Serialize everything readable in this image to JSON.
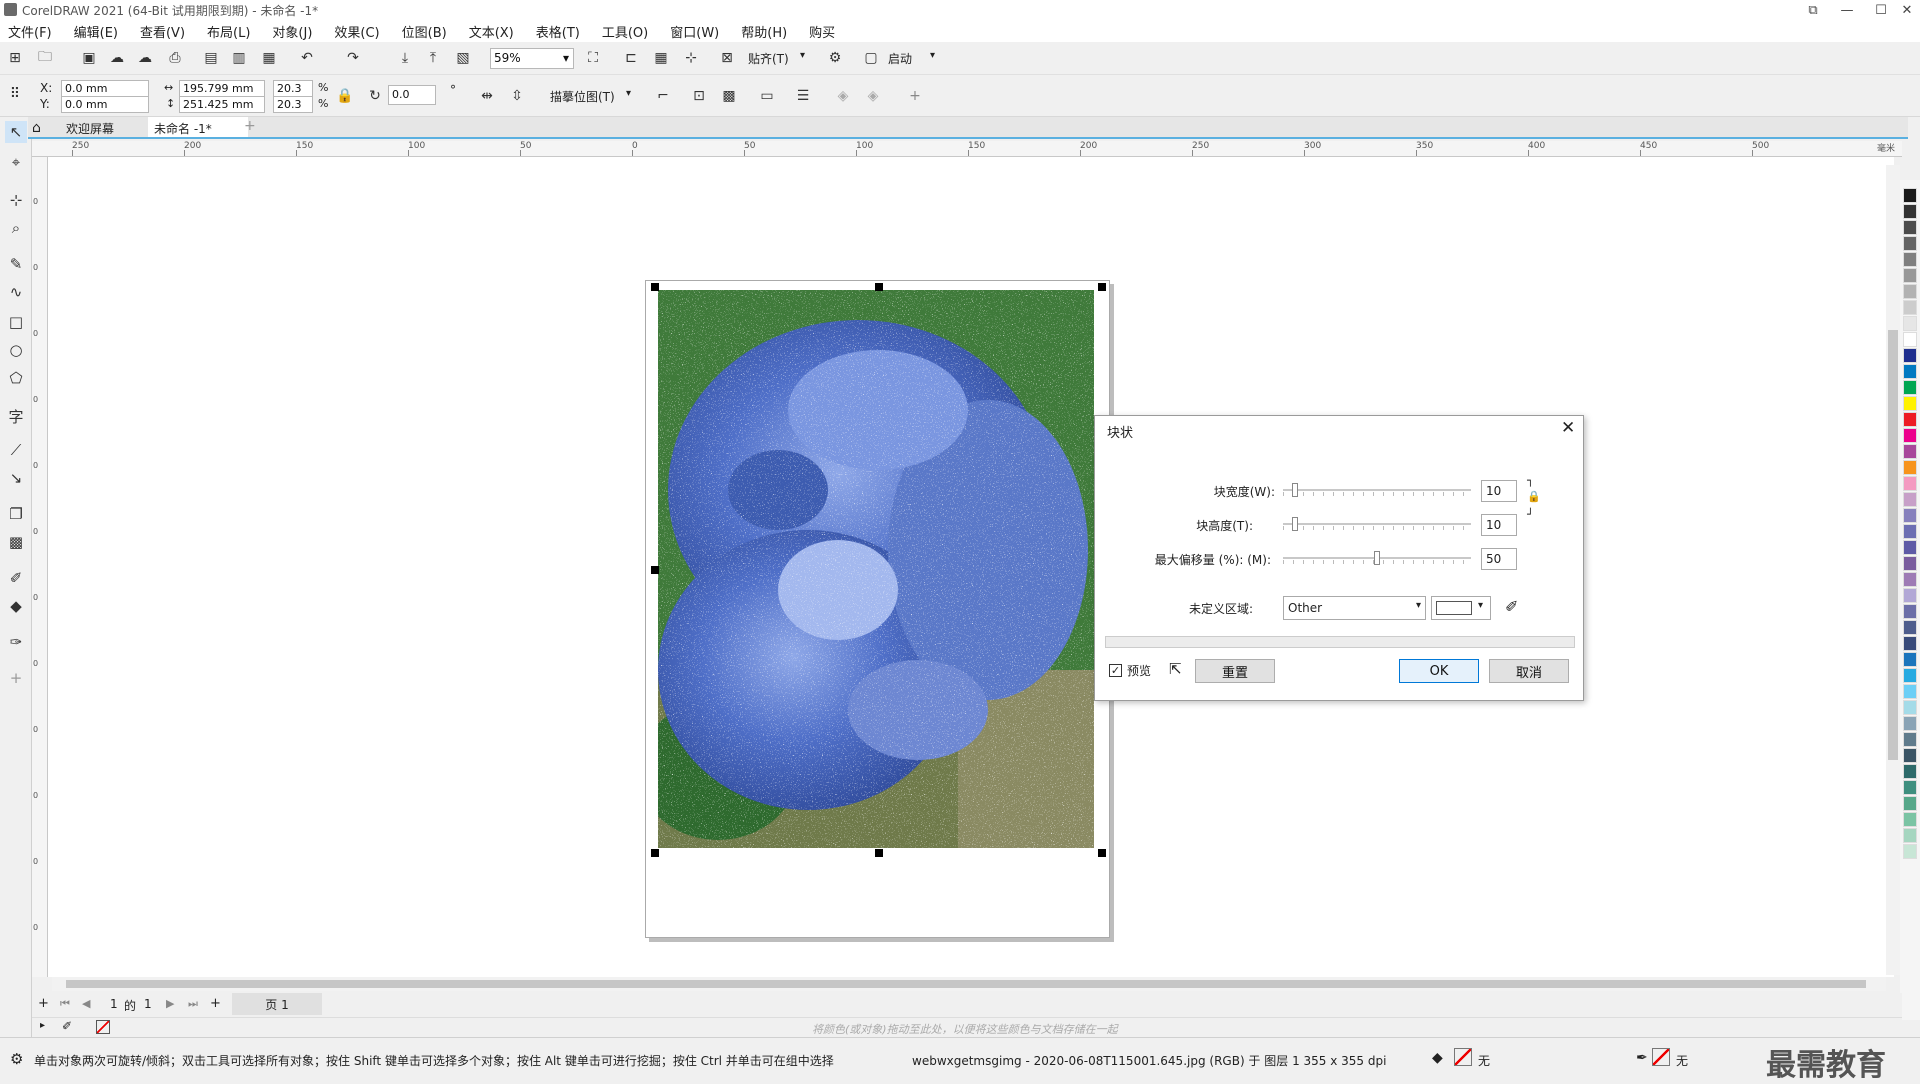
{
  "window": {
    "title": "CorelDRAW 2021 (64-Bit 试用期限到期) - 未命名 -1*"
  },
  "menu": [
    "文件(F)",
    "编辑(E)",
    "查看(V)",
    "布局(L)",
    "对象(J)",
    "效果(C)",
    "位图(B)",
    "文本(X)",
    "表格(T)",
    "工具(O)",
    "窗口(W)",
    "帮助(H)",
    "购买"
  ],
  "toolbar": {
    "zoom": "59%",
    "snap_label": "贴齐(T)",
    "launch_label": "启动"
  },
  "propbar": {
    "x_label": "X:",
    "y_label": "Y:",
    "x_value": "0.0 mm",
    "y_value": "0.0 mm",
    "width_value": "195.799 mm",
    "height_value": "251.425 mm",
    "scale_w": "20.3",
    "scale_h": "20.3",
    "percent": "%",
    "rotation": "0.0",
    "degree": "°",
    "trace_label": "描摹位图(T)"
  },
  "tabs": {
    "welcome": "欢迎屏幕",
    "document": "未命名 -1*"
  },
  "ruler": {
    "h_labels": [
      "250",
      "200",
      "150",
      "100",
      "50",
      "0",
      "50",
      "100",
      "150",
      "200",
      "250",
      "300",
      "350",
      "400",
      "450",
      "500"
    ],
    "unit": "毫米",
    "v_labels": [
      "0",
      "0",
      "0",
      "0",
      "0",
      "0",
      "0",
      "0",
      "0",
      "0",
      "0",
      "0"
    ]
  },
  "dialog": {
    "title": "块状",
    "width_label": "块宽度(W):",
    "height_label": "块高度(T):",
    "offset_label": "最大偏移量 (%): (M):",
    "undefined_label": "未定义区域:",
    "width_value": "10",
    "height_value": "10",
    "offset_value": "50",
    "width_level": 0.05,
    "height_level": 0.05,
    "offset_level": 0.5,
    "undefined_option": "Other",
    "preview_label": "预览",
    "preview_checked": true,
    "reset_label": "重置",
    "ok_label": "OK",
    "cancel_label": "取消"
  },
  "pagenav": {
    "current": "1",
    "of": "的",
    "total": "1",
    "page_tab": "页 1"
  },
  "colorbar_hint": "将颜色(或对象)拖动至此处，以便将这些颜色与文档存储在一起",
  "status": {
    "hint": "单击对象两次可旋转/倾斜；双击工具可选择所有对象；按住 Shift 键单击可选择多个对象；按住 Alt 键单击可进行挖掘；按住 Ctrl 并单击可在组中选择",
    "object_info": "webwxgetmsgimg - 2020-06-08T115001.645.jpg (RGB) 于 图层 1 355 x 355 dpi",
    "fill_none": "无",
    "outline_none": "无"
  },
  "watermark": "最需教育",
  "palette_colors": [
    "#1a1a1a",
    "#333333",
    "#4d4d4d",
    "#666666",
    "#808080",
    "#999999",
    "#b3b3b3",
    "#cccccc",
    "#e6e6e6",
    "#ffffff",
    "#1f2f8f",
    "#0079c1",
    "#00a651",
    "#fff200",
    "#ed1c24",
    "#ec008c",
    "#a7469a",
    "#f7941d",
    "#f49ac1",
    "#c7a0c8",
    "#8781bd",
    "#6d6fb3",
    "#5e5aa6",
    "#7a5c9e",
    "#9e7bb5",
    "#b2a8d6",
    "#6c6fa8",
    "#4e5d8c",
    "#394b7a",
    "#1c75bc",
    "#27aae1",
    "#6dcff6",
    "#a4dbe8",
    "#8aa3b5",
    "#5f7b8c",
    "#3b5566",
    "#2e6b6b",
    "#3f8f7f",
    "#57a88a",
    "#7bc4a4",
    "#a6d6c0",
    "#c8e6d6"
  ],
  "colors": {
    "accent": "#5ab0e0",
    "ok_border": "#0078d7"
  }
}
